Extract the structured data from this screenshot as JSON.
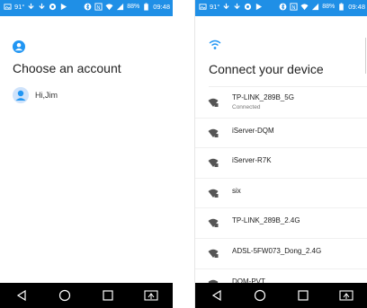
{
  "statusbar": {
    "sim": "91°",
    "battery": "88%",
    "time": "09:48"
  },
  "accounts_screen": {
    "title": "Choose an account",
    "accounts": [
      {
        "name": "Hi,Jim"
      }
    ]
  },
  "wifi_screen": {
    "title": "Connect your device",
    "networks": [
      {
        "ssid": "TP-LINK_289B_5G",
        "status": "Connected"
      },
      {
        "ssid": "iServer-DQM"
      },
      {
        "ssid": "iServer-R7K"
      },
      {
        "ssid": "six"
      },
      {
        "ssid": "TP-LINK_289B_2.4G"
      },
      {
        "ssid": "ADSL-5FW073_Dong_2.4G"
      },
      {
        "ssid": "DQM-PVT"
      }
    ]
  },
  "colors": {
    "statusbar": "#1f8fe6",
    "accent": "#2196f3",
    "navbar": "#000000"
  },
  "navbar": {
    "buttons": [
      "back-icon",
      "home-icon",
      "recents-icon",
      "screen-mirror-icon"
    ]
  }
}
